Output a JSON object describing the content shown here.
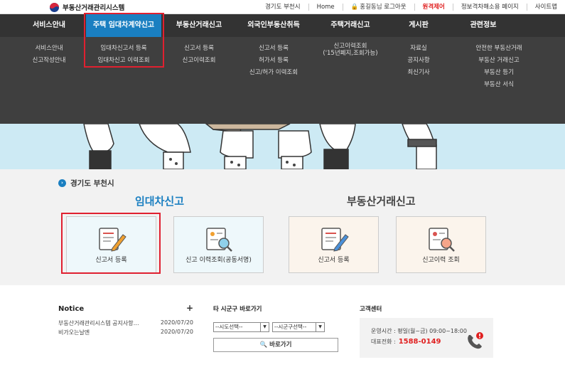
{
  "brand": {
    "name": "부동산거래관리시스템"
  },
  "topnav": {
    "region": "경기도 부천시",
    "home": "Home",
    "user": "홍길동님 로그아웃",
    "remote": "원격제어",
    "accessibility": "정보격차해소용 페이지",
    "sitemap": "사이트맵"
  },
  "gnb": {
    "menus": [
      {
        "label": "서비스안내",
        "subs": [
          "서비스안내",
          "신고작성안내"
        ]
      },
      {
        "label": "주택 임대차계약신고",
        "subs": [
          "임대차신고서 등록",
          "임대차신고 이력조회"
        ]
      },
      {
        "label": "부동산거래신고",
        "subs": [
          "신고서 등록",
          "신고이력조회"
        ]
      },
      {
        "label": "외국인부동산취득",
        "subs": [
          "신고서 등록",
          "허가서 등록",
          "신고/허가 이력조회"
        ]
      },
      {
        "label": "주택거래신고",
        "subs": [
          "신고이력조회",
          "('15년폐지,조회가능)"
        ]
      },
      {
        "label": "게시판",
        "subs": [
          "자료실",
          "공지사항",
          "최신기사"
        ]
      },
      {
        "label": "관련정보",
        "subs": [
          "안전한 부동산거래",
          "부동산 거래신고",
          "부동산 등기",
          "부동산 서식"
        ]
      }
    ]
  },
  "location": {
    "label": "경기도 부천시",
    "icon": "chevron-right-icon"
  },
  "sections": {
    "lease": "임대차신고",
    "trade": "부동산거래신고"
  },
  "cards": [
    {
      "label": "신고서 등록",
      "icon": "form-pencil-icon"
    },
    {
      "label": "신고 이력조회(공동서명)",
      "icon": "document-search-icon"
    },
    {
      "label": "신고서 등록",
      "icon": "form-pencil-icon"
    },
    {
      "label": "신고이력 조회",
      "icon": "document-search-icon"
    }
  ],
  "notice": {
    "title": "Notice",
    "more": "+",
    "items": [
      {
        "title": "부동산거래관리시스템 공지사항…",
        "date": "2020/07/20"
      },
      {
        "title": "비가오는날엔",
        "date": "2020/07/20"
      }
    ]
  },
  "shortcut": {
    "title": "타 시군구 바로가기",
    "sido": "--시도선택--",
    "sigungu": "--시군구선택--",
    "go": "바로가기"
  },
  "contact": {
    "title": "고객센터",
    "hours": "운영시간 : 평일(월~금) 09:00~18:00",
    "phone_label": "대표전화 :",
    "phone": "1588-0149"
  },
  "colors": {
    "accent": "#1a7fc1",
    "highlight": "#e02030",
    "lease": "#1a7fc1",
    "dark": "#333333"
  }
}
